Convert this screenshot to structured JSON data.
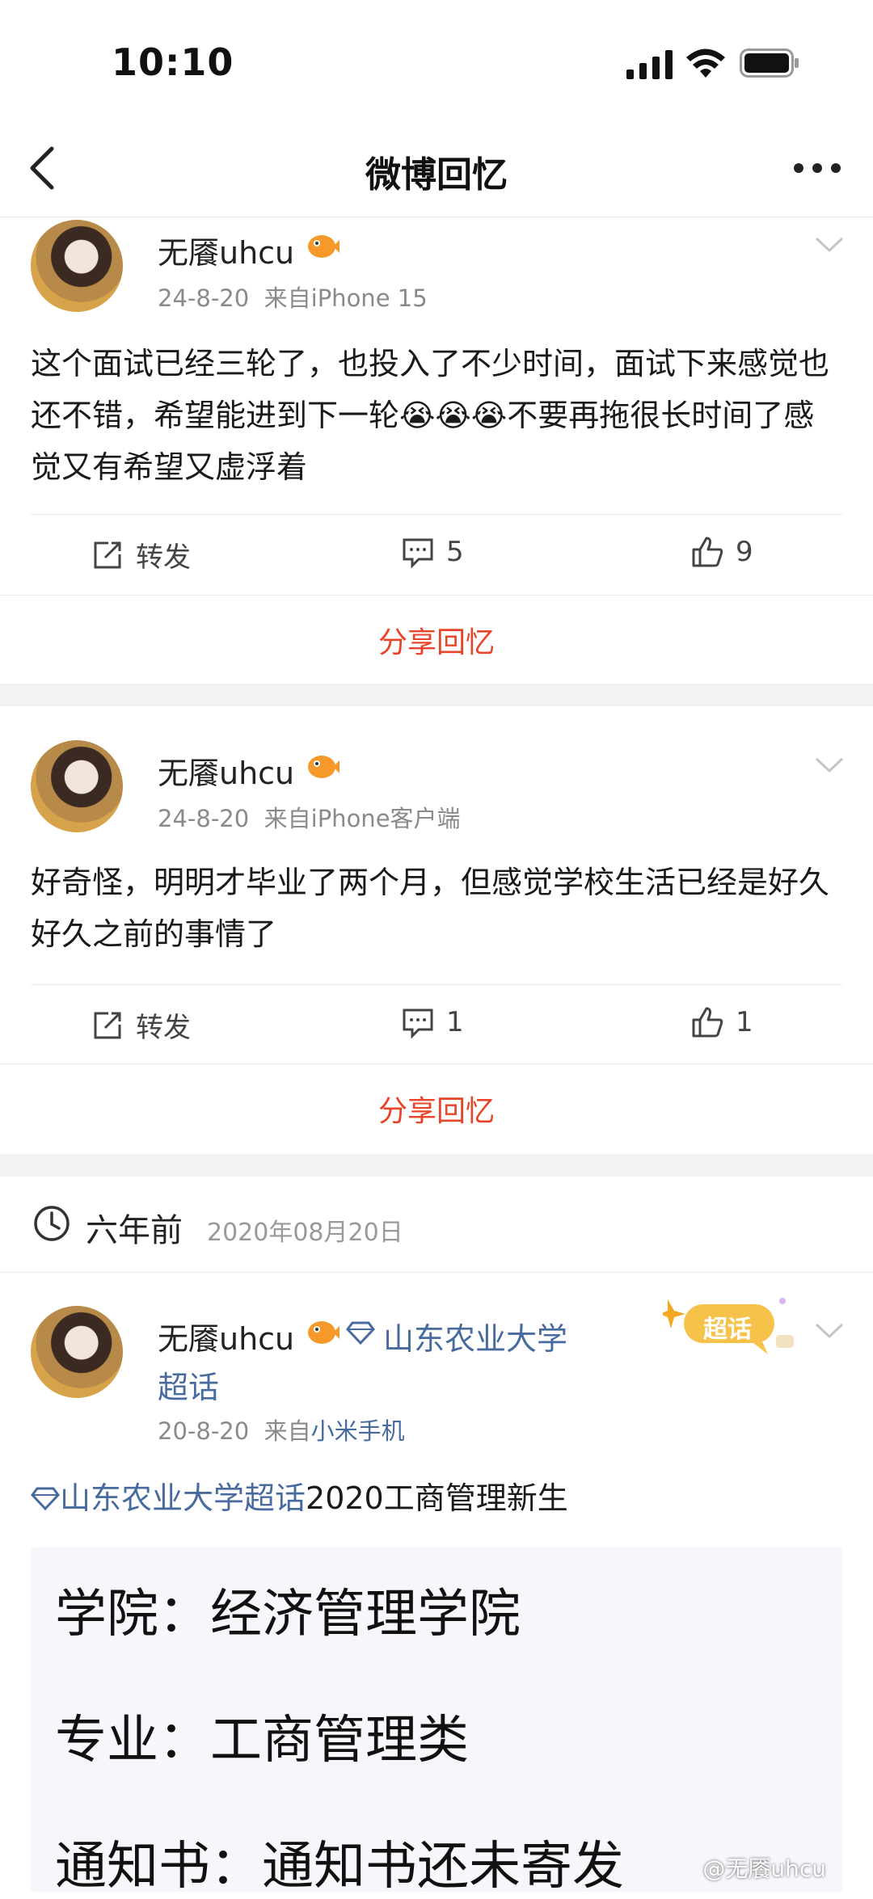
{
  "status": {
    "time": "10:10"
  },
  "nav": {
    "title": "微博回忆"
  },
  "posts": [
    {
      "user": "无餍uhcu",
      "date": "24-8-20",
      "source_prefix": "来自",
      "source": "iPhone 15",
      "text": "这个面试已经三轮了，也投入了不少时间，面试下来感觉也还不错，希望能进到下一轮😭😭😭不要再拖很长时间了感觉又有希望又虚浮着",
      "repost_label": "转发",
      "comments": "5",
      "likes": "9",
      "share_label": "分享回忆"
    },
    {
      "user": "无餍uhcu",
      "date": "24-8-20",
      "source_prefix": "来自",
      "source": "iPhone客户端",
      "text": "好奇怪，明明才毕业了两个月，但感觉学校生活已经是好久好久之前的事情了",
      "repost_label": "转发",
      "comments": "1",
      "likes": "1",
      "share_label": "分享回忆"
    }
  ],
  "section": {
    "label": "六年前",
    "date": "2020年08月20日"
  },
  "post3": {
    "user": "无餍uhcu",
    "topic_line1": "山东农业大学",
    "topic_line2": "超话",
    "super_tag": "超话",
    "date": "20-8-20",
    "source_prefix": "来自",
    "source": "小米手机",
    "topic": "山东农业大学超话",
    "text": "2020工商管理新生",
    "image_lines": [
      "学院：经济管理学院",
      "专业：工商管理类",
      "通知书：通知书还未寄发"
    ],
    "watermark": "@无餍uhcu"
  },
  "colors": {
    "share": "#e8442a",
    "link": "#476b9e",
    "gap": "#f2f2f2"
  }
}
